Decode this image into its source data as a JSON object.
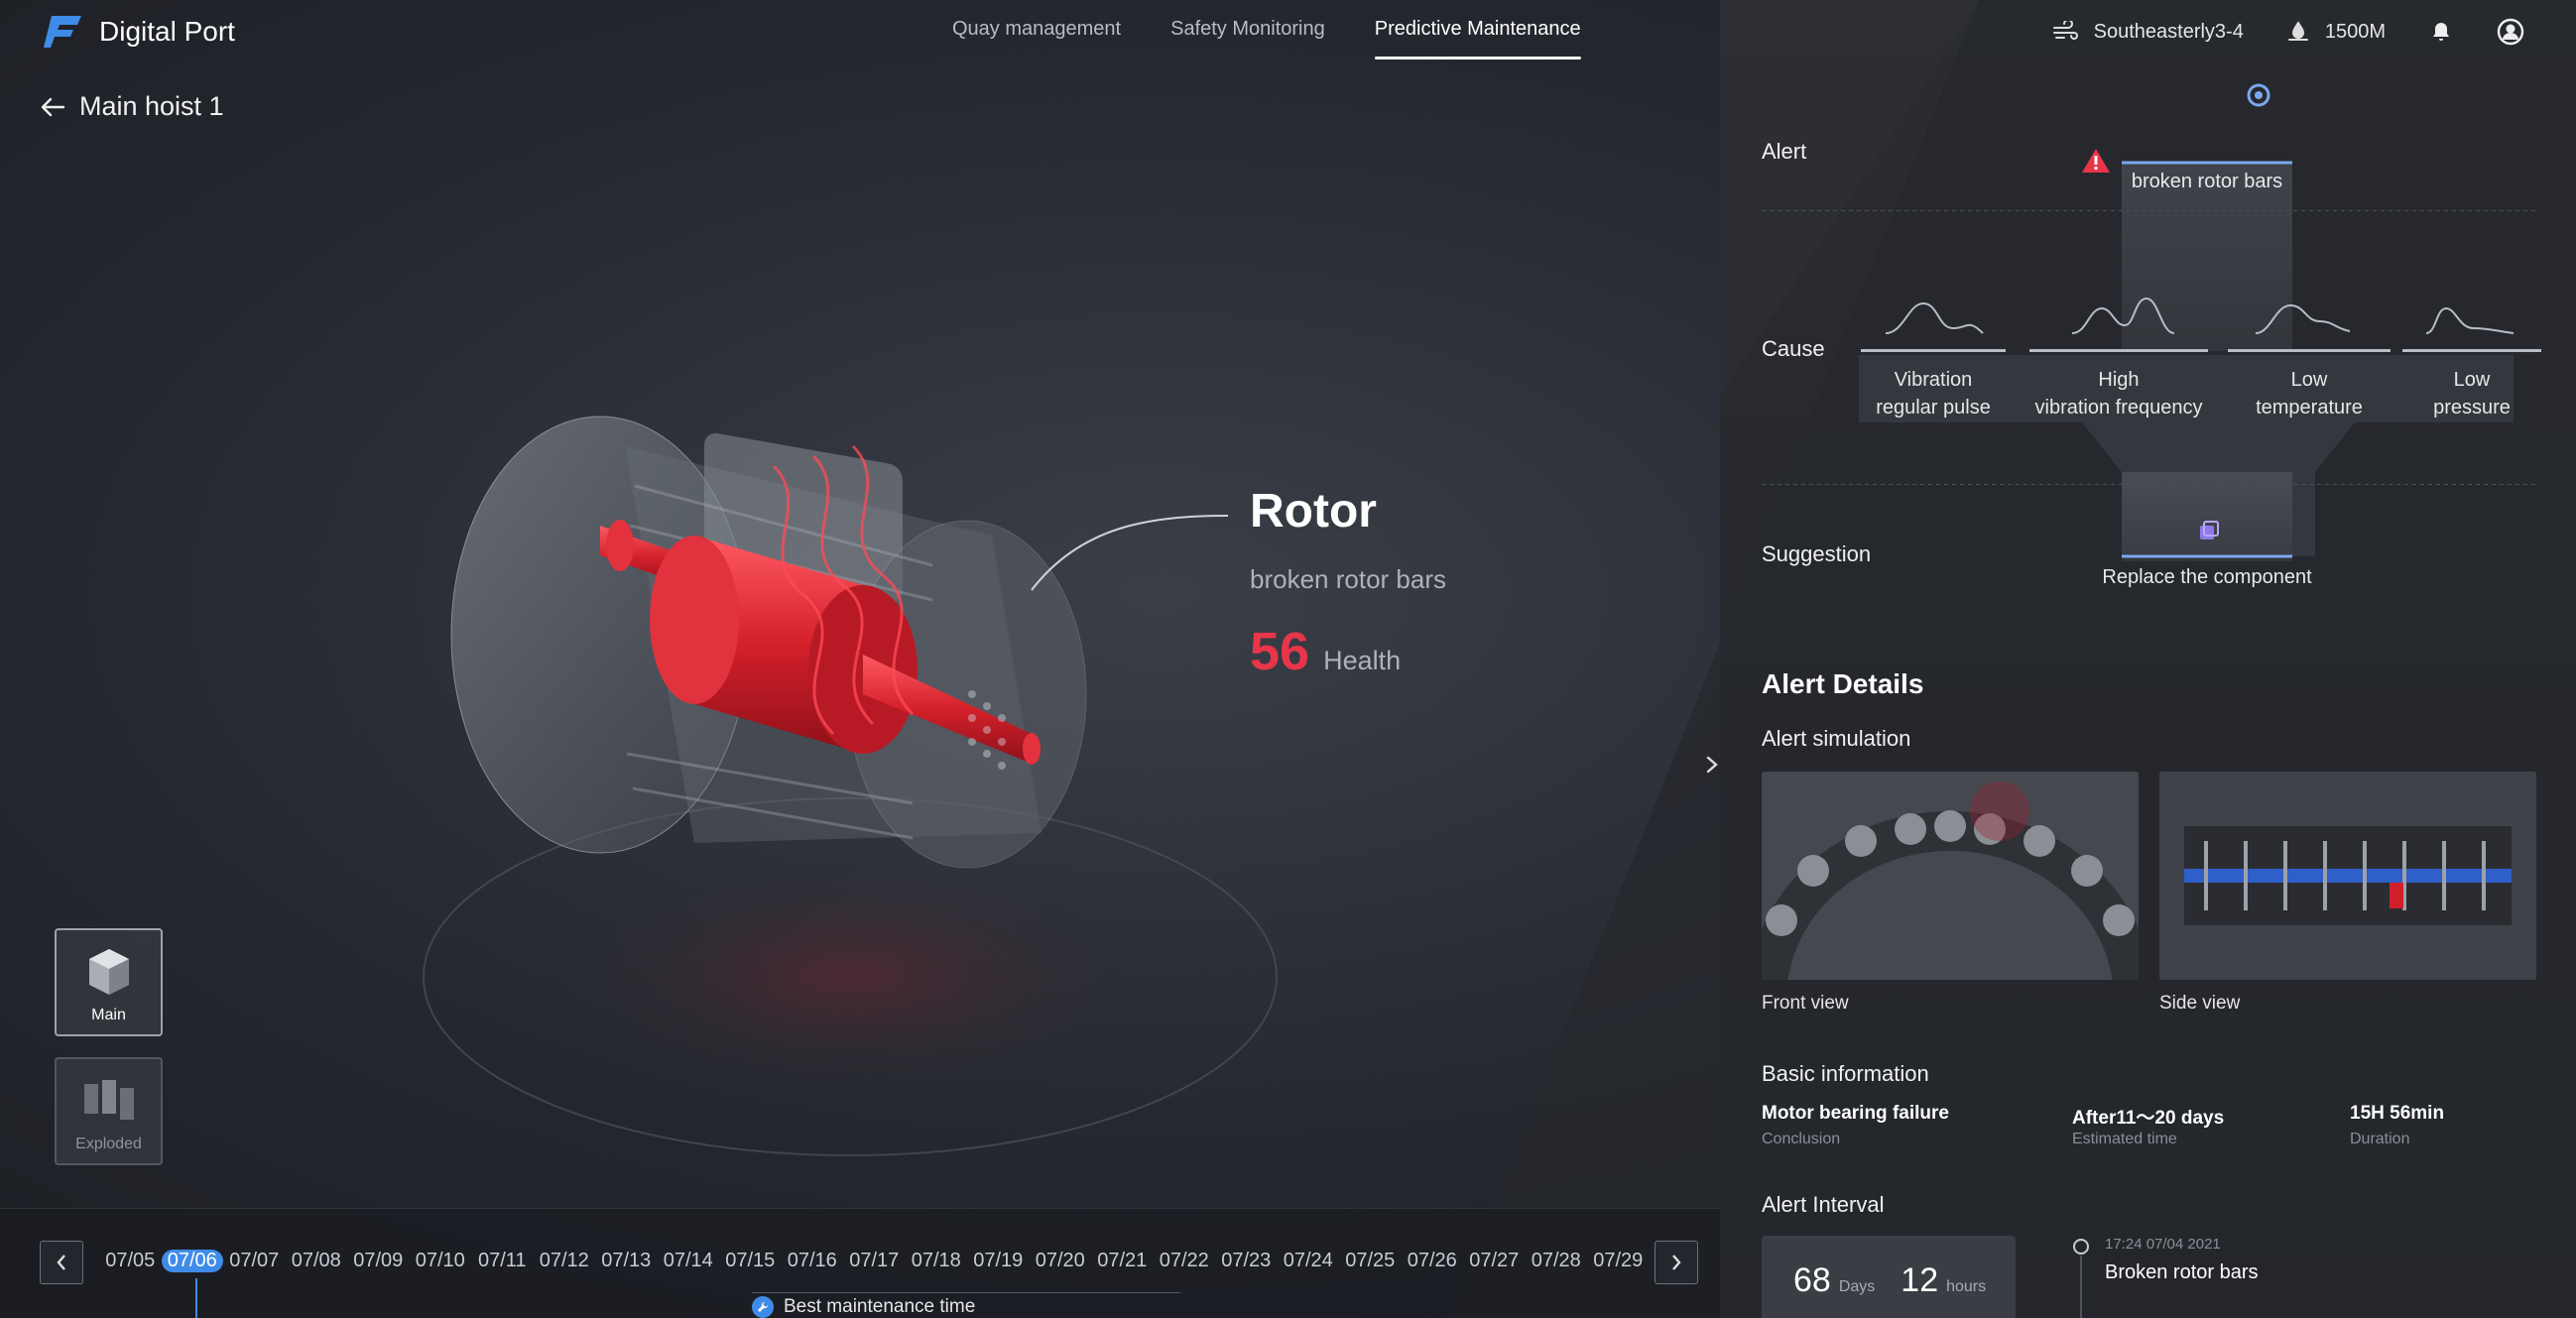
{
  "app": {
    "title": "Digital Port"
  },
  "nav": {
    "items": [
      {
        "label": "Quay management"
      },
      {
        "label": "Safety Monitoring"
      },
      {
        "label": "Predictive Maintenance"
      }
    ]
  },
  "status": {
    "wind": "Southeasterly3-4",
    "depth": "1500M"
  },
  "back": {
    "label": "Main hoist 1"
  },
  "component": {
    "name": "Rotor",
    "fault": "broken rotor bars",
    "health_value": "56",
    "health_label": "Health"
  },
  "views": {
    "main": "Main",
    "exploded": "Exploded"
  },
  "timeline": {
    "dates": [
      "07/05",
      "07/06",
      "07/07",
      "07/08",
      "07/09",
      "07/10",
      "07/11",
      "07/12",
      "07/13",
      "07/14",
      "07/15",
      "07/16",
      "07/17",
      "07/18",
      "07/19",
      "07/20",
      "07/21",
      "07/22",
      "07/23",
      "07/24",
      "07/25",
      "07/26",
      "07/27",
      "07/28",
      "07/29"
    ],
    "selected": "07/06",
    "best_label": "Best maintenance time"
  },
  "analysis": {
    "alert_label": "Alert",
    "alert_value": "broken rotor bars",
    "cause_label": "Cause",
    "causes": [
      {
        "line1": "Vibration",
        "line2": "regular pulse"
      },
      {
        "line1": "High",
        "line2": "vibration frequency"
      },
      {
        "line1": "Low",
        "line2": "temperature"
      },
      {
        "line1": "Low",
        "line2": "pressure"
      }
    ],
    "suggestion_label": "Suggestion",
    "suggestion_value": "Replace the component"
  },
  "details": {
    "title": "Alert Details",
    "simulation_label": "Alert simulation",
    "front_view": "Front view",
    "side_view": "Side view",
    "basic_info_label": "Basic information",
    "info": [
      {
        "value": "Motor bearing failure",
        "key": "Conclusion"
      },
      {
        "value": "After11～20 days",
        "key": "Estimated time"
      },
      {
        "value": "15H 56min",
        "key": "Duration"
      }
    ],
    "interval_label": "Alert Interval",
    "interval": {
      "days": "68",
      "days_unit": "Days",
      "hours": "12",
      "hours_unit": "hours"
    },
    "event": {
      "time": "17:24 07/04 2021",
      "title": "Broken rotor bars"
    }
  },
  "colors": {
    "accent": "#3f8ce8",
    "alert": "#e8354a"
  }
}
